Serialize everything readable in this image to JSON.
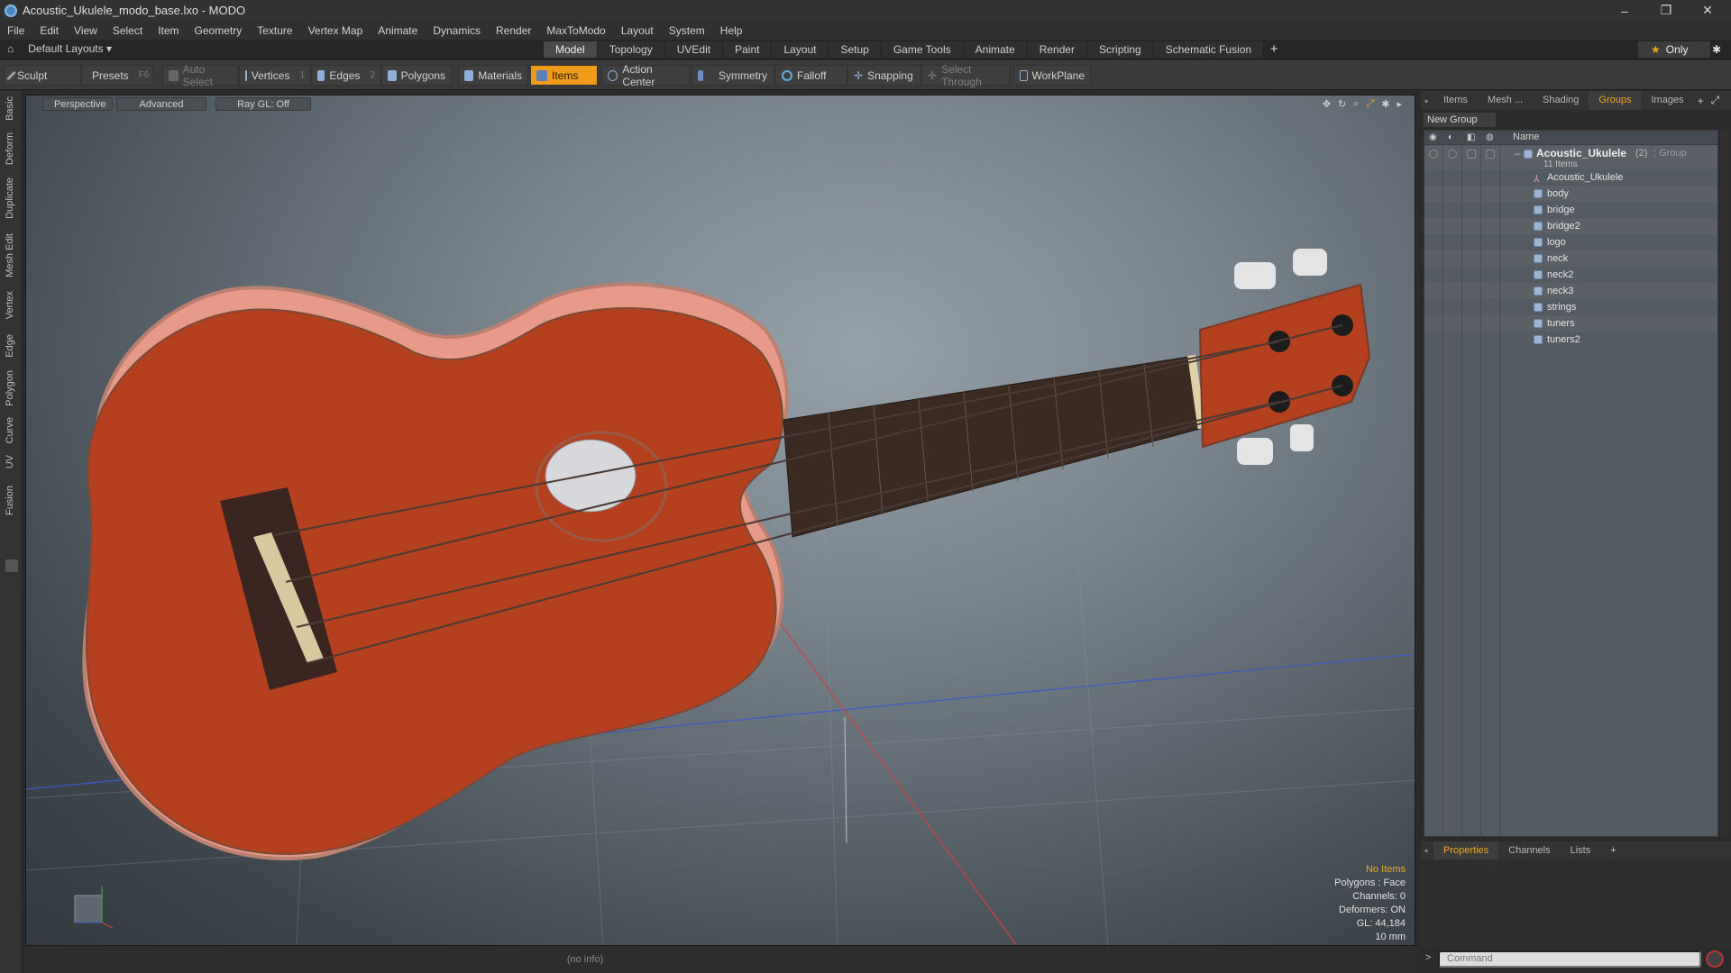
{
  "window": {
    "title": "Acoustic_Ukulele_modo_base.lxo - MODO",
    "minimize": "–",
    "restore": "❐",
    "close": "✕"
  },
  "menu": [
    "File",
    "Edit",
    "View",
    "Select",
    "Item",
    "Geometry",
    "Texture",
    "Vertex Map",
    "Animate",
    "Dynamics",
    "Render",
    "MaxToModo",
    "Layout",
    "System",
    "Help"
  ],
  "layoutbar": {
    "layout_select": "Default Layouts",
    "tabs": [
      "Model",
      "Topology",
      "UVEdit",
      "Paint",
      "Layout",
      "Setup",
      "Game Tools",
      "Animate",
      "Render",
      "Scripting",
      "Schematic Fusion"
    ],
    "active_tab": "Model",
    "only_label": "Only"
  },
  "toolbar": {
    "sculpt": "Sculpt",
    "presets": "Presets",
    "presets_key": "F6",
    "auto_select": "Auto Select",
    "vertices": "Vertices",
    "vertices_key": "1",
    "edges": "Edges",
    "edges_key": "2",
    "polygons": "Polygons",
    "materials": "Materials",
    "items": "Items",
    "action_center": "Action Center",
    "symmetry": "Symmetry",
    "falloff": "Falloff",
    "snapping": "Snapping",
    "select_through": "Select Through",
    "workplane": "WorkPlane"
  },
  "left_tabs": [
    "Basic",
    "Deform",
    "Duplicate",
    "Mesh Edit",
    "Vertex",
    "Edge",
    "Polygon",
    "Curve",
    "UV",
    "Fusion"
  ],
  "viewport": {
    "view_mode": "Perspective",
    "shading": "Advanced",
    "raygl": "Ray GL: Off",
    "info": {
      "selection": "No Items",
      "polygons": "Polygons : Face",
      "channels": "Channels: 0",
      "deformers": "Deformers: ON",
      "gl": "GL: 44,184",
      "grid": "10 mm"
    }
  },
  "status": "(no info)",
  "right_panel": {
    "tabs": [
      "Items",
      "Mesh ...",
      "Shading",
      "Groups",
      "Images"
    ],
    "active_tab": "Groups",
    "new_group": "New Group",
    "column_name": "Name",
    "group": {
      "name": "Acoustic_Ukulele",
      "count": "(2)",
      "type": ": Group",
      "subtitle": "11 Items"
    },
    "items": [
      "Acoustic_Ukulele",
      "body",
      "bridge",
      "bridge2",
      "logo",
      "neck",
      "neck2",
      "neck3",
      "strings",
      "tuners",
      "tuners2"
    ]
  },
  "properties": {
    "tabs": [
      "Properties",
      "Channels",
      "Lists"
    ],
    "active_tab": "Properties",
    "command_placeholder": "Command"
  },
  "colors": {
    "accent": "#ee9a1a",
    "ukulele_body": "#b5401f",
    "fretboard": "#3a2a22"
  }
}
